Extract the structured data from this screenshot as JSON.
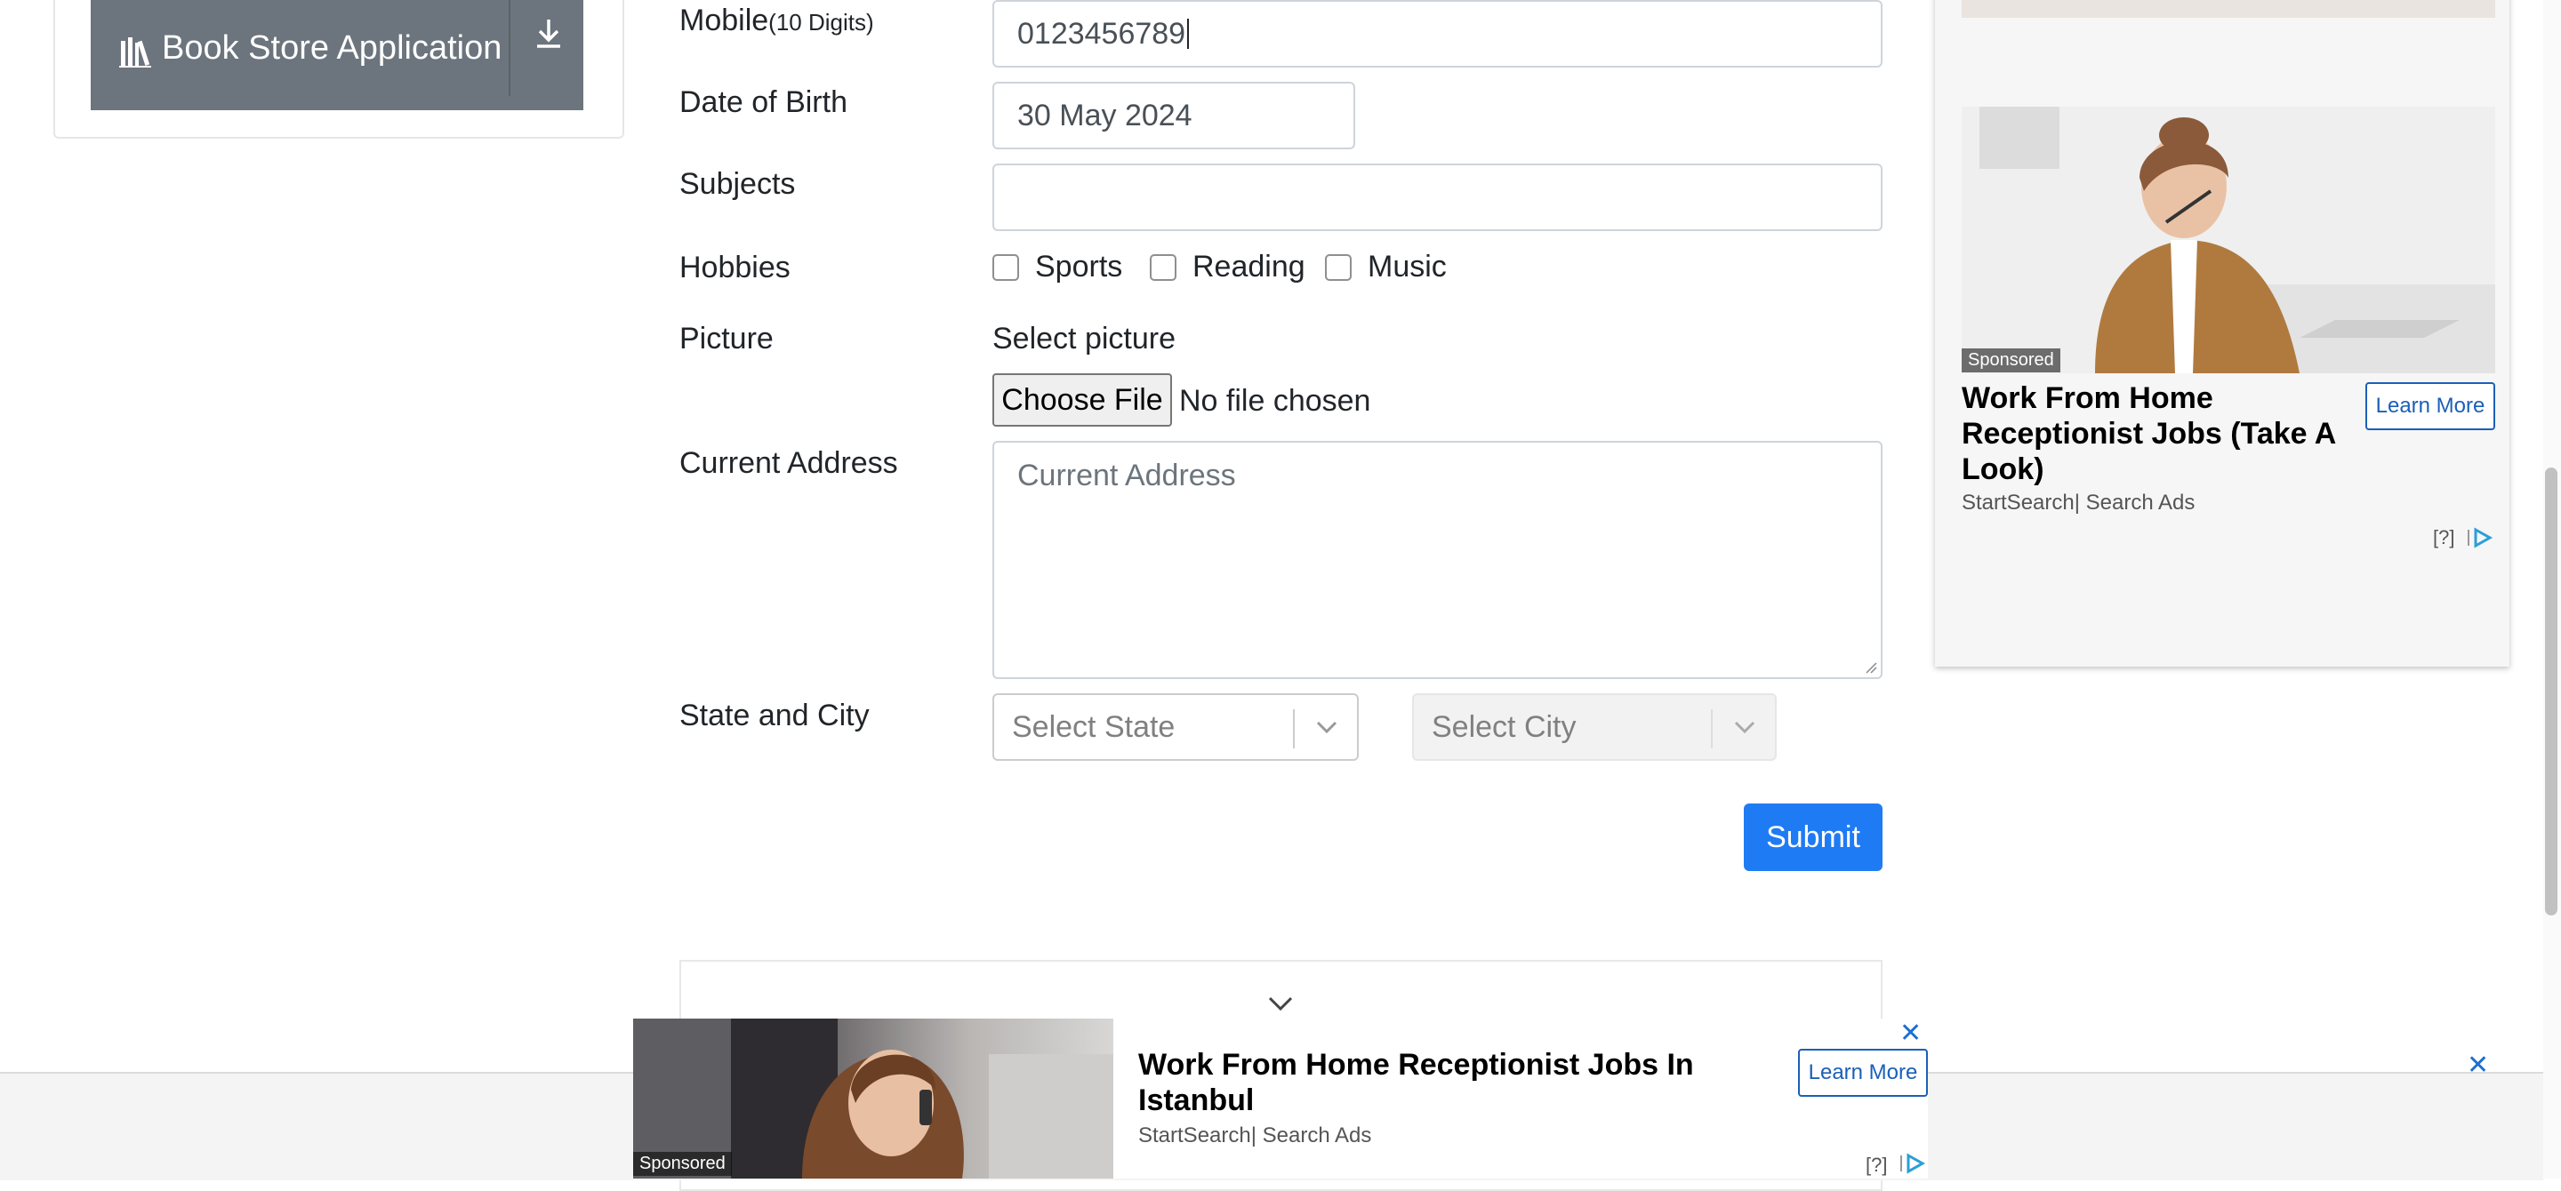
{
  "sidebar": {
    "book_store_label": "Book Store Application"
  },
  "form": {
    "mobile_label": "Mobile",
    "mobile_hint": "(10 Digits)",
    "mobile_value": "0123456789",
    "dob_label": "Date of Birth",
    "dob_value": "30 May 2024",
    "subjects_label": "Subjects",
    "subjects_value": "",
    "hobbies_label": "Hobbies",
    "hobbies": [
      "Sports",
      "Reading",
      "Music"
    ],
    "picture_label": "Picture",
    "select_picture_label": "Select picture",
    "choose_file_label": "Choose File",
    "no_file_text": "No file chosen",
    "address_label": "Current Address",
    "address_placeholder": "Current Address",
    "state_city_label": "State and City",
    "state_placeholder": "Select State",
    "city_placeholder": "Select City",
    "submit_label": "Submit"
  },
  "right_ad": {
    "sponsored": "Sponsored",
    "title": "Work From Home Receptionist Jobs (Take A Look)",
    "source": "StartSearch| Search Ads",
    "learn_more": "Learn More",
    "help": "[?]"
  },
  "bottom_ad": {
    "sponsored": "Sponsored",
    "title": "Work From Home Receptionist Jobs In Istanbul",
    "source": "StartSearch| Search Ads",
    "learn_more": "Learn More",
    "help": "[?]"
  },
  "colors": {
    "primary": "#1f7bf4",
    "secondary_button": "#6c757d",
    "ad_link": "#1b5fb9"
  }
}
